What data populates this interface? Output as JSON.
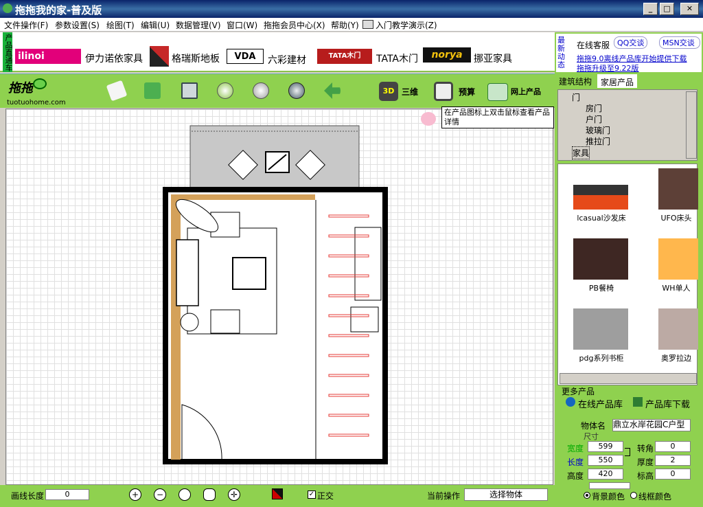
{
  "window": {
    "title": "拖拖我的家-普及版"
  },
  "menu": [
    "文件操作(F)",
    "参数设置(S)",
    "绘图(T)",
    "编辑(U)",
    "数据管理(V)",
    "窗口(W)",
    "拖拖会员中心(X)",
    "帮助(Y)",
    "入门教学演示(Z)"
  ],
  "sidetab": "产品直通车",
  "brands": {
    "b1": "伊力诺依家具",
    "b1_logo": "ilinoi",
    "b2": "格瑞斯地板",
    "b3": "六彩建材",
    "b3_logo": "VDA",
    "b4": "TATA木门",
    "b4_logo": "TATA木门",
    "b5": "挪亚家具",
    "b5_logo": "norya"
  },
  "toolbar": {
    "logo_text": "tuotuohome.com",
    "btn_3d": "三维",
    "btn_3d_badge": "3D",
    "btn_budget": "预算",
    "btn_online": "网上产品"
  },
  "tooltip": "在产品图标上双击鼠标查看产品详情",
  "status": {
    "line_length_label": "画线长度",
    "line_length": "0",
    "ortho_label": "正交",
    "current_op_label": "当前操作",
    "current_op": "选择物体"
  },
  "news": {
    "tag": "最新动态",
    "service": "在线客服",
    "qq": "QQ交谈",
    "msn": "MSN交谈",
    "link1": "拖拖9.0离线产品库开始提供下载",
    "link2": "拖拖升级至9.22版"
  },
  "tabs": {
    "t1": "建筑结构",
    "t2": "家居产品"
  },
  "tree": {
    "root1": "门",
    "c1": "房门",
    "c2": "户门",
    "c3": "玻璃门",
    "c4": "推拉门",
    "root2": "家具"
  },
  "products": {
    "p1": "lcasual沙发床",
    "p2": "UFO床头",
    "p3": "PB餐椅",
    "p4": "WH单人",
    "p5": "pdg系列书柜",
    "p6": "奥罗拉边"
  },
  "more": {
    "label": "更多产品",
    "online": "在线产品库",
    "download": "产品库下载"
  },
  "props": {
    "name_label": "物体名",
    "name": "鼎立水岸花园C户型",
    "size_label": "尺寸",
    "width_label": "宽度",
    "width": "599",
    "length_label": "长度",
    "length": "550",
    "height_label": "高度",
    "height": "420",
    "rot_label": "转角",
    "rot": "0",
    "thick_label": "厚度",
    "thick": "2",
    "elev_label": "标高",
    "elev": "0",
    "bg_color": "背景颜色",
    "line_color": "线框颜色"
  }
}
